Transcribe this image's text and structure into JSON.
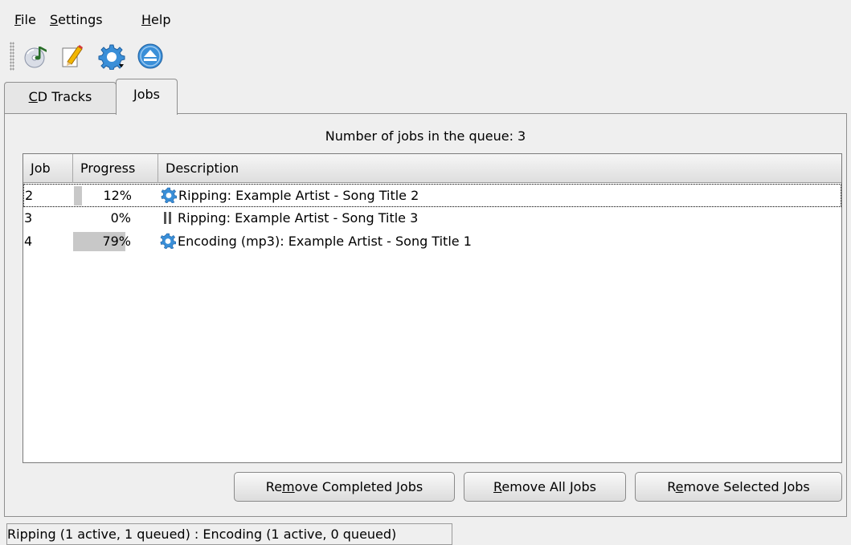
{
  "menu": [
    {
      "label": "File",
      "mnemonic": "F",
      "rest": "ile"
    },
    {
      "label": "Settings",
      "mnemonic": "S",
      "rest": "ettings"
    },
    {
      "label": "Help",
      "mnemonic": "H",
      "rest": "elp"
    }
  ],
  "toolbar": {
    "icons": [
      "cd-audio-rip-icon",
      "edit-pencil-icon",
      "configure-gear-dropdown-icon",
      "eject-icon"
    ]
  },
  "tabs": [
    {
      "label": "CD Tracks",
      "mnemonic": "C",
      "rest": "D Tracks",
      "active": false
    },
    {
      "label": "Jobs",
      "pre": "",
      "mnemonic": "J",
      "rest": "obs",
      "active": true
    }
  ],
  "queue_label": "Number of jobs in the queue: 3",
  "jobs_table": {
    "columns": [
      "Job",
      "Progress",
      "Description"
    ],
    "rows": [
      {
        "job": "2",
        "progress": 0.12,
        "progress_text": "12%",
        "status_icon": "gear-running-icon",
        "description": "Ripping: Example Artist - Song Title 2",
        "selected": true
      },
      {
        "job": "3",
        "progress": 0.0,
        "progress_text": "0%",
        "status_icon": "pause-icon",
        "description": "Ripping: Example Artist - Song Title 3",
        "selected": false
      },
      {
        "job": "4",
        "progress": 0.79,
        "progress_text": "79%",
        "status_icon": "gear-running-icon",
        "description": "Encoding (mp3): Example Artist - Song Title 1",
        "selected": false
      }
    ]
  },
  "buttons": {
    "remove_completed": {
      "label": "Remove Completed Jobs",
      "pre": "Re",
      "mnemonic": "m",
      "rest": "ove Completed Jobs"
    },
    "remove_all": {
      "label": "Remove All Jobs",
      "pre": "",
      "mnemonic": "R",
      "rest": "emove All Jobs"
    },
    "remove_selected": {
      "label": "Remove Selected Jobs",
      "pre": "R",
      "mnemonic": "e",
      "rest": "move Selected Jobs"
    }
  },
  "status_bar": "Ripping (1 active, 1 queued) : Encoding (1 active, 0 queued)",
  "colors": {
    "accent_blue": "#3a8fd8",
    "progress_fill": "#c8c8c8",
    "window_bg": "#efefef"
  }
}
